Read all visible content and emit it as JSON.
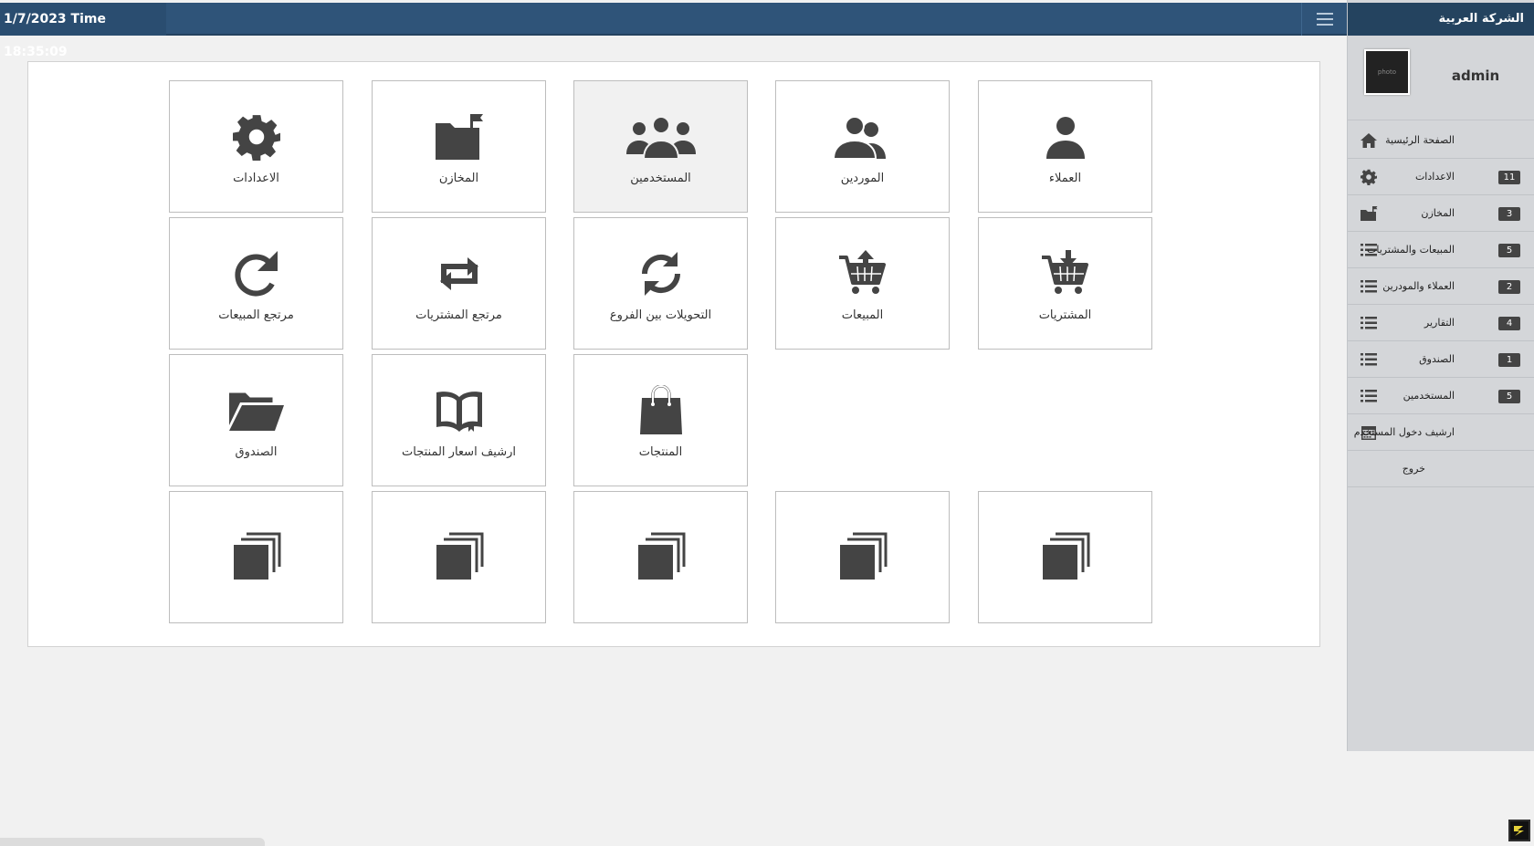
{
  "header": {
    "datetime": "1/7/2023 Time 18:35:09",
    "company": "الشركة العربية",
    "menu_icon": "hamburger-icon"
  },
  "profile": {
    "photo_text": "photo",
    "username": "admin"
  },
  "sidebar": {
    "items": [
      {
        "label": "الصفحة الرئيسية",
        "icon": "home-icon",
        "badge": ""
      },
      {
        "label": "الاعدادات",
        "icon": "gear-icon",
        "badge": "11"
      },
      {
        "label": "المخازن",
        "icon": "folder-flag-icon",
        "badge": "3"
      },
      {
        "label": "المبيعات والمشتريات",
        "icon": "list-icon",
        "badge": "5"
      },
      {
        "label": "العملاء والمودرين",
        "icon": "list-icon",
        "badge": "2"
      },
      {
        "label": "التقارير",
        "icon": "list-icon",
        "badge": "4"
      },
      {
        "label": "الصندوق",
        "icon": "list-icon",
        "badge": "1"
      },
      {
        "label": "المستخدمين",
        "icon": "list-icon",
        "badge": "5"
      },
      {
        "label": "ارشيف دخول المستخدم",
        "icon": "calendar-icon",
        "badge": ""
      },
      {
        "label": "خروج",
        "icon": "",
        "badge": ""
      }
    ]
  },
  "tiles": {
    "row1": [
      {
        "label": "العملاء",
        "icon": "user-icon"
      },
      {
        "label": "الموردين",
        "icon": "user-pair-icon"
      },
      {
        "label": "المستخدمين",
        "icon": "users-group-icon"
      },
      {
        "label": "المخازن",
        "icon": "folder-flag-icon"
      },
      {
        "label": "الاعدادات",
        "icon": "gear-icon"
      }
    ],
    "row2": [
      {
        "label": "المشتريات",
        "icon": "cart-download-icon"
      },
      {
        "label": "المبيعات",
        "icon": "cart-upload-icon"
      },
      {
        "label": "التحويلات بين الفروع",
        "icon": "refresh-cycle-icon"
      },
      {
        "label": "مرتجع المشتريات",
        "icon": "retweet-icon"
      },
      {
        "label": "مرتجع المبيعات",
        "icon": "redo-icon"
      }
    ],
    "row3": [
      {
        "label": "المنتجات",
        "icon": "shopping-bag-icon"
      },
      {
        "label": "ارشيف اسعار المنتجات",
        "icon": "open-book-icon"
      },
      {
        "label": "الصندوق",
        "icon": "open-folder-icon"
      }
    ],
    "row4_icon": "stacked-copies-icon"
  },
  "colors": {
    "topbar": "#2f5479",
    "sidebar_head": "#24435f",
    "icon": "#444444"
  }
}
